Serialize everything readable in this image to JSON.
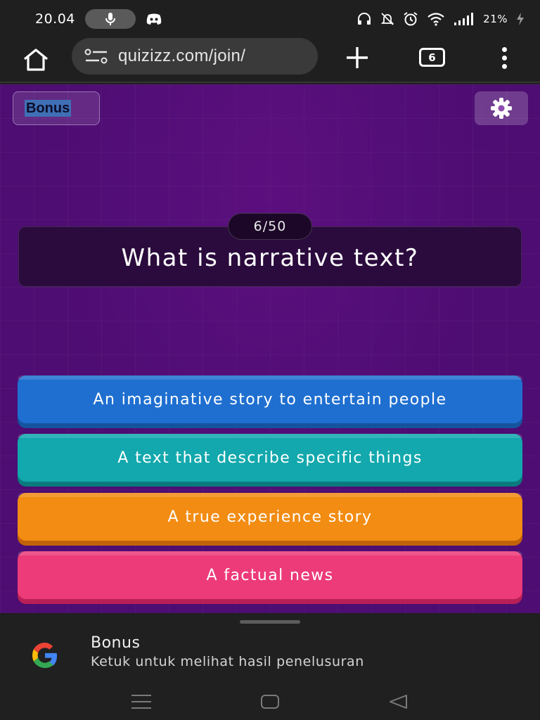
{
  "status_bar": {
    "time": "20.04",
    "battery": "21%",
    "icons": [
      "mic-icon",
      "discord-icon",
      "headphones-icon",
      "bell-off-icon",
      "alarm-icon",
      "wifi-icon",
      "signal-icon",
      "charging-icon"
    ]
  },
  "browser": {
    "url": "quizizz.com/join/",
    "tab_count": "6",
    "icons": [
      "home-icon",
      "site-settings-icon",
      "plus-icon",
      "tabs-icon",
      "more-vert-icon"
    ]
  },
  "quiz": {
    "bonus_label": "Bonus",
    "counter": "6/50",
    "question": "What is narrative text?",
    "answers": [
      {
        "text": "An imaginative story to entertain people",
        "color": "#1f6fd0"
      },
      {
        "text": "A text that describe specific things",
        "color": "#12a8ad"
      },
      {
        "text": "A true experience story",
        "color": "#f28c12"
      },
      {
        "text": "A factual news",
        "color": "#ec3b78"
      }
    ],
    "background_color": "#4d0d72"
  },
  "bottom_sheet": {
    "title": "Bonus",
    "subtitle": "Ketuk untuk melihat hasil penelusuran",
    "logo": "google-g-icon"
  },
  "nav": {
    "icons": [
      "recents-icon",
      "home-nav-icon",
      "back-icon"
    ]
  }
}
